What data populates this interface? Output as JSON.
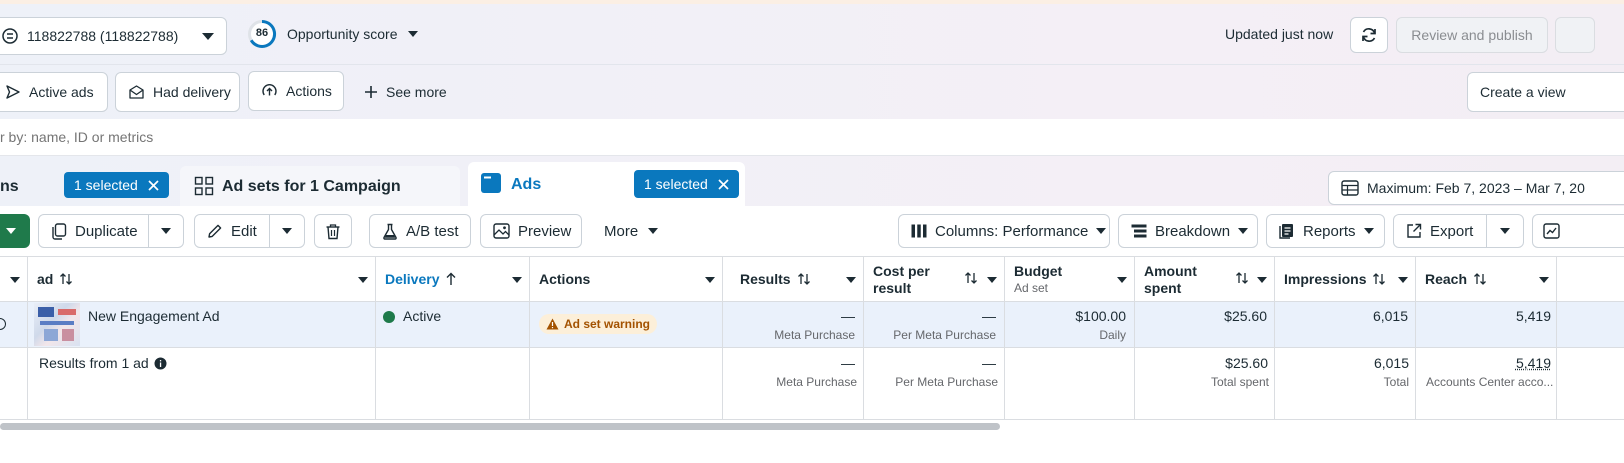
{
  "header": {
    "account_selector": "118822788 (118822788)",
    "opportunity_score_value": "86",
    "opportunity_score_label": "Opportunity score",
    "updated_status": "Updated just now",
    "review_publish_label": "Review and publish"
  },
  "filters": {
    "active_ads": "Active ads",
    "had_delivery": "Had delivery",
    "actions": "Actions",
    "see_more": "See more",
    "create_view": "Create a view",
    "search_placeholder": "r by: name, ID or metrics"
  },
  "tabs": {
    "campaigns_partial": "ns",
    "campaigns_selected": "1 selected",
    "adsets_label": "Ad sets for 1 Campaign",
    "ads_label": "Ads",
    "ads_selected": "1 selected",
    "date_range": "Maximum: Feb 7, 2023 – Mar 7, 20"
  },
  "toolbar": {
    "duplicate": "Duplicate",
    "edit": "Edit",
    "ab_test": "A/B test",
    "preview": "Preview",
    "more": "More",
    "columns": "Columns: Performance",
    "breakdown": "Breakdown",
    "reports": "Reports",
    "export": "Export"
  },
  "table": {
    "headers": {
      "ad": "ad",
      "delivery": "Delivery",
      "actions": "Actions",
      "results": "Results",
      "cost_per_result_1": "Cost per",
      "cost_per_result_2": "result",
      "budget": "Budget",
      "budget_sub": "Ad set",
      "amount_spent_1": "Amount",
      "amount_spent_2": "spent",
      "impressions": "Impressions",
      "reach": "Reach"
    },
    "row": {
      "ad_name": "New Engagement Ad",
      "delivery": "Active",
      "warning": "Ad set warning",
      "results": "—",
      "results_sub": "Meta Purchase",
      "cost": "—",
      "cost_sub": "Per Meta Purchase",
      "budget": "$100.00",
      "budget_sub": "Daily",
      "amount_spent": "$25.60",
      "impressions": "6,015",
      "reach": "5,419"
    },
    "summary": {
      "label": "Results from 1 ad",
      "results": "—",
      "results_sub": "Meta Purchase",
      "cost": "—",
      "cost_sub": "Per Meta Purchase",
      "amount_spent": "$25.60",
      "amount_spent_sub": "Total spent",
      "impressions": "6,015",
      "impressions_sub": "Total",
      "reach": "5,419",
      "reach_sub": "Accounts Center acco..."
    }
  },
  "colors": {
    "accent_blue": "#0a78be",
    "delivery_green": "#1e7a4a",
    "warning_bg": "#fcefd9",
    "warning_text": "#a35200",
    "publish_green": "#1f7a4b"
  }
}
